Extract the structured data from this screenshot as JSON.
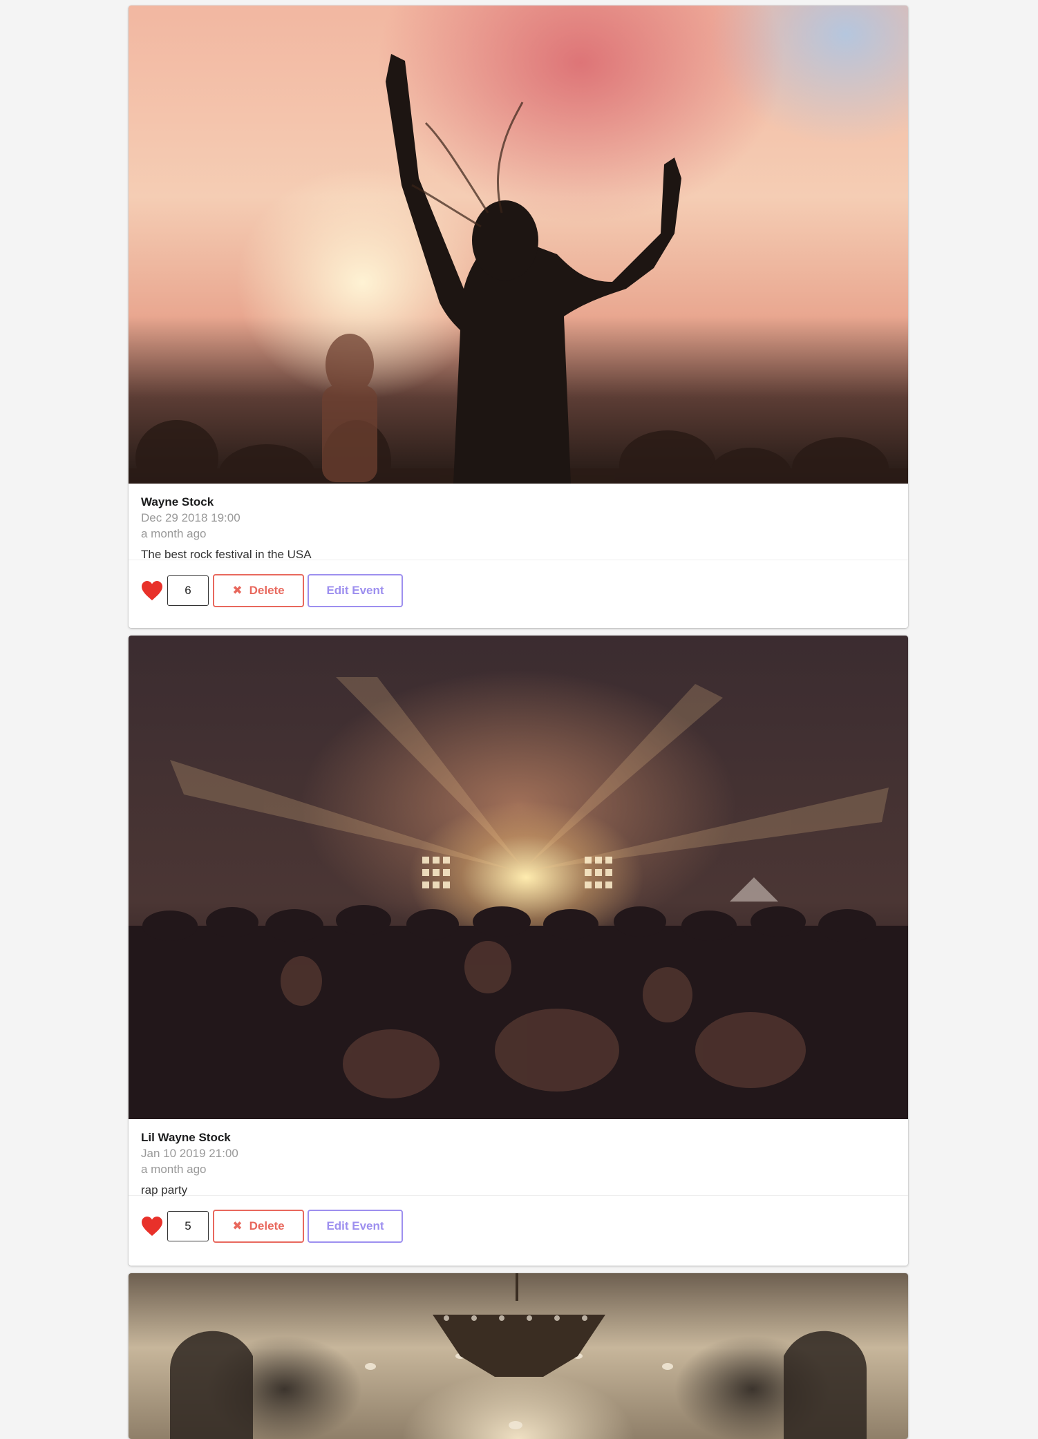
{
  "events": [
    {
      "image_alt": "festival crowd with woman dancing in colored smoke",
      "title": "Wayne Stock",
      "date": "Dec 29 2018 19:00",
      "relative_time": "a month ago",
      "description": "The best rock festival in the USA",
      "likes": "6",
      "delete_label": "Delete",
      "edit_label": "Edit Event"
    },
    {
      "image_alt": "concert crowd facing bright stage lights",
      "title": "Lil Wayne Stock",
      "date": "Jan 10 2019 21:00",
      "relative_time": "a month ago",
      "description": "rap party",
      "likes": "5",
      "delete_label": "Delete",
      "edit_label": "Edit Event"
    },
    {
      "image_alt": "ornate ballroom with chandelier"
    }
  ],
  "icons": {
    "like": "heart-icon",
    "delete": "x-icon",
    "delete_glyph": "✖"
  },
  "colors": {
    "heart": "#e8312a",
    "delete": "#e8685d",
    "edit": "#9d8fef",
    "background": "#f4f4f4"
  }
}
